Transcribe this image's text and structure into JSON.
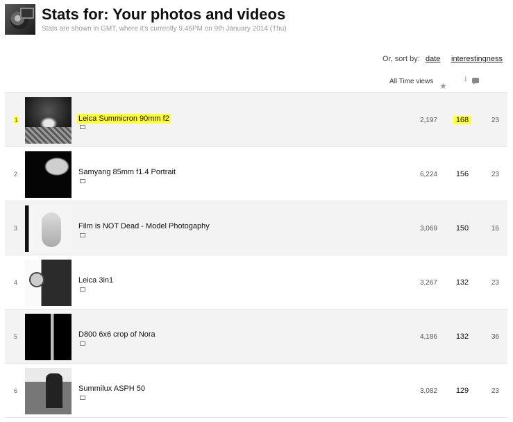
{
  "header": {
    "title": "Stats for: Your photos and videos",
    "subtitle": "Stats are shown in GMT, where it's currently 9.46PM on 9th January 2014 (Thu)"
  },
  "sort": {
    "label": "Or, sort by:",
    "date": "date",
    "interestingness": "interestingness"
  },
  "columns": {
    "views_label": "All Time views",
    "favs_icon": "star-icon",
    "sort_arrow": "↓",
    "comments_icon": "comment-icon"
  },
  "highlight_color": "#ffff33",
  "photos": [
    {
      "rank": "1",
      "title": "Leica Summicron 90mm f2",
      "views": "2,197",
      "favs": "168",
      "comments": "23",
      "highlighted": true
    },
    {
      "rank": "2",
      "title": "Samyang 85mm f1.4 Portrait",
      "views": "6,224",
      "favs": "156",
      "comments": "23"
    },
    {
      "rank": "3",
      "title": "Film is NOT Dead - Model Photogaphy",
      "views": "3,069",
      "favs": "150",
      "comments": "16"
    },
    {
      "rank": "4",
      "title": "Leica 3in1",
      "views": "3,267",
      "favs": "132",
      "comments": "23"
    },
    {
      "rank": "5",
      "title": "D800 6x6 crop of Nora",
      "views": "4,186",
      "favs": "132",
      "comments": "36"
    },
    {
      "rank": "6",
      "title": "Summilux ASPH 50",
      "views": "3,082",
      "favs": "129",
      "comments": "23"
    }
  ]
}
